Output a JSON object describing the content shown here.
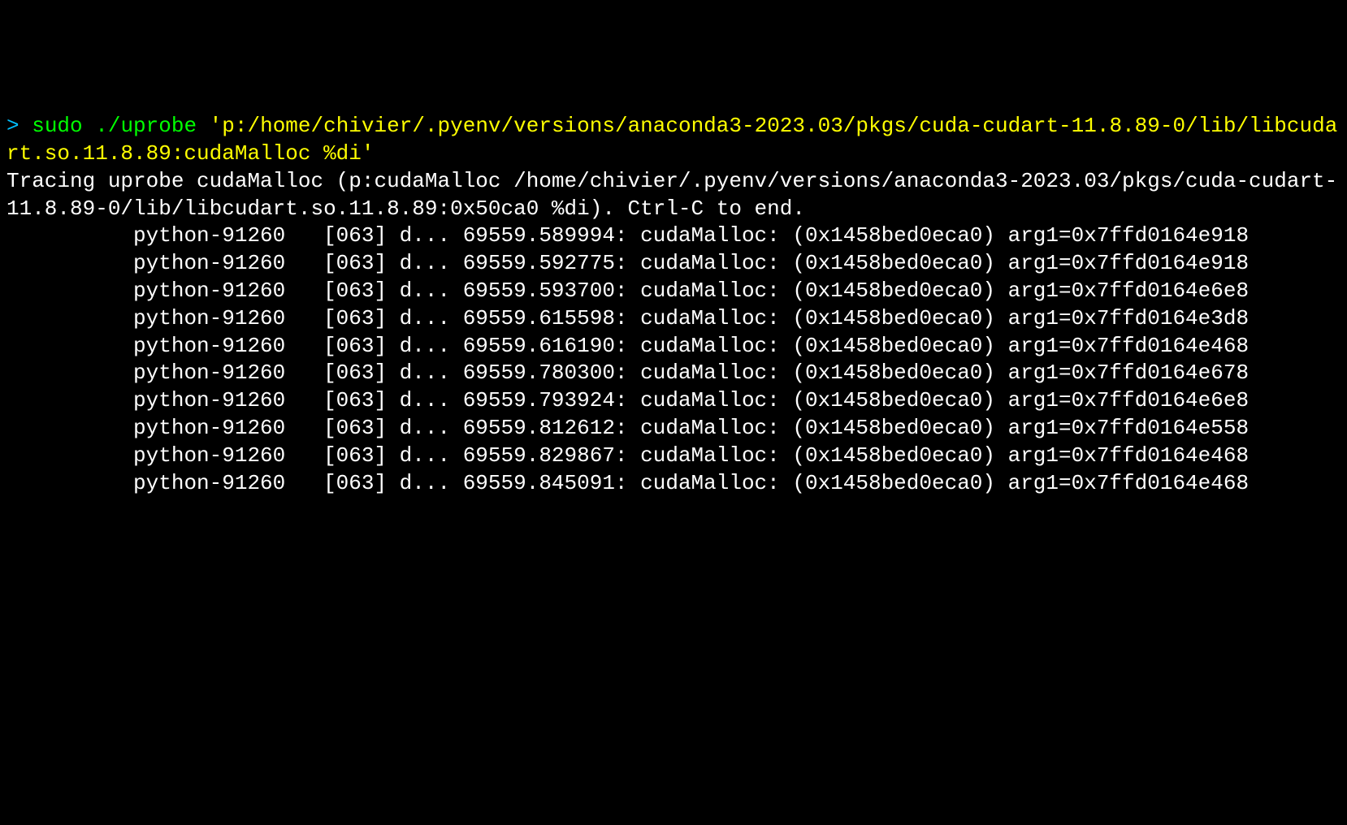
{
  "prompt": "> ",
  "command_sudo": "sudo",
  "command_space": " ",
  "command_uprobe": "./uprobe",
  "argument": " 'p:/home/chivier/.pyenv/versions/anaconda3-2023.03/pkgs/cuda-cudart-11.8.89-0/lib/libcudart.so.11.8.89:cudaMalloc %di'",
  "tracing_header": "Tracing uprobe cudaMalloc (p:cudaMalloc /home/chivier/.pyenv/versions/anaconda3-2023.03/pkgs/cuda-cudart-11.8.89-0/lib/libcudart.so.11.8.89:0x50ca0 %di). Ctrl-C to end.",
  "trace_lines": [
    "          python-91260   [063] d... 69559.589994: cudaMalloc: (0x1458bed0eca0) arg1=0x7ffd0164e918",
    "          python-91260   [063] d... 69559.592775: cudaMalloc: (0x1458bed0eca0) arg1=0x7ffd0164e918",
    "          python-91260   [063] d... 69559.593700: cudaMalloc: (0x1458bed0eca0) arg1=0x7ffd0164e6e8",
    "          python-91260   [063] d... 69559.615598: cudaMalloc: (0x1458bed0eca0) arg1=0x7ffd0164e3d8",
    "          python-91260   [063] d... 69559.616190: cudaMalloc: (0x1458bed0eca0) arg1=0x7ffd0164e468",
    "          python-91260   [063] d... 69559.780300: cudaMalloc: (0x1458bed0eca0) arg1=0x7ffd0164e678",
    "          python-91260   [063] d... 69559.793924: cudaMalloc: (0x1458bed0eca0) arg1=0x7ffd0164e6e8",
    "          python-91260   [063] d... 69559.812612: cudaMalloc: (0x1458bed0eca0) arg1=0x7ffd0164e558",
    "          python-91260   [063] d... 69559.829867: cudaMalloc: (0x1458bed0eca0) arg1=0x7ffd0164e468",
    "          python-91260   [063] d... 69559.845091: cudaMalloc: (0x1458bed0eca0) arg1=0x7ffd0164e468"
  ]
}
